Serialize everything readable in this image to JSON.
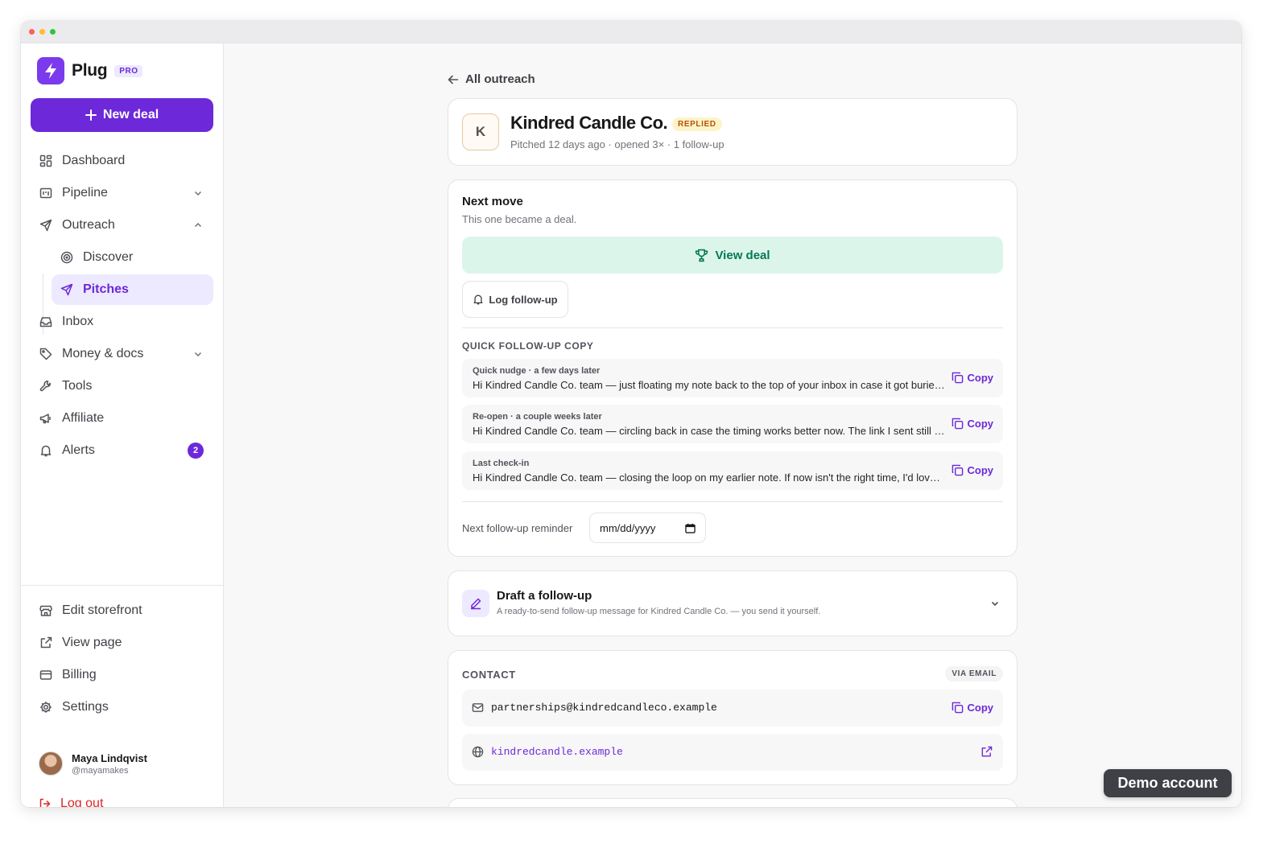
{
  "brand": {
    "name": "Plug",
    "tier": "PRO"
  },
  "sidebar": {
    "new_deal": "New deal",
    "items": [
      {
        "label": "Dashboard"
      },
      {
        "label": "Pipeline"
      },
      {
        "label": "Outreach"
      },
      {
        "label": "Discover"
      },
      {
        "label": "Pitches"
      },
      {
        "label": "Inbox"
      },
      {
        "label": "Money & docs"
      },
      {
        "label": "Tools"
      },
      {
        "label": "Affiliate"
      },
      {
        "label": "Alerts",
        "badge": "2"
      }
    ],
    "bottom": [
      {
        "label": "Edit storefront"
      },
      {
        "label": "View page"
      },
      {
        "label": "Billing"
      },
      {
        "label": "Settings"
      }
    ],
    "user": {
      "name": "Maya Lindqvist",
      "handle": "@mayamakes"
    },
    "logout": "Log out"
  },
  "main": {
    "back": "All outreach",
    "header": {
      "initial": "K",
      "company": "Kindred Candle Co.",
      "status": "REPLIED",
      "meta": "Pitched 12 days ago · opened 3× · 1 follow-up"
    },
    "next_move": {
      "title": "Next move",
      "subtitle": "This one became a deal.",
      "view_deal": "View deal",
      "log_followup": "Log follow-up",
      "quick_copy_heading": "QUICK FOLLOW-UP COPY",
      "copy_label": "Copy",
      "templates": [
        {
          "title": "Quick nudge · a few days later",
          "body": "Hi Kindred Candle Co. team — just floating my note back to the top of your inbox in case it got buried. Happy to share more ideas whenever works for you."
        },
        {
          "title": "Re-open · a couple weeks later",
          "body": "Hi Kindred Candle Co. team — circling back in case the timing works better now. The link I sent still has everything in one place."
        },
        {
          "title": "Last check-in",
          "body": "Hi Kindred Candle Co. team — closing the loop on my earlier note. If now isn't the right time, I'd love to stay in touch for future campaigns."
        }
      ],
      "reminder_label": "Next follow-up reminder",
      "reminder_placeholder": "mm/dd/yyyy"
    },
    "draft": {
      "title": "Draft a follow-up",
      "subtitle": "A ready-to-send follow-up message for Kindred Candle Co. — you send it yourself."
    },
    "contact": {
      "heading": "CONTACT",
      "via": "VIA EMAIL",
      "email": "partnerships@kindredcandleco.example",
      "website": "kindredcandle.example",
      "copy_label": "Copy"
    }
  },
  "demo_badge": "Demo account",
  "colors": {
    "accent": "#6d28d9",
    "success": "#047857",
    "success_bg": "#dcf5ea",
    "danger": "#dc2626",
    "warning": "#b45309"
  },
  "icons": [
    "bolt-icon",
    "plus-icon",
    "grid-icon",
    "pipeline-icon",
    "send-icon",
    "target-icon",
    "inbox-icon",
    "tag-icon",
    "wrench-icon",
    "megaphone-icon",
    "bell-icon",
    "store-icon",
    "external-link-icon",
    "credit-card-icon",
    "gear-icon",
    "logout-icon",
    "arrow-left-icon",
    "trophy-icon",
    "copy-icon",
    "calendar-icon",
    "pencil-icon",
    "mail-icon",
    "globe-icon",
    "chevron-down-icon",
    "chevron-up-icon"
  ]
}
